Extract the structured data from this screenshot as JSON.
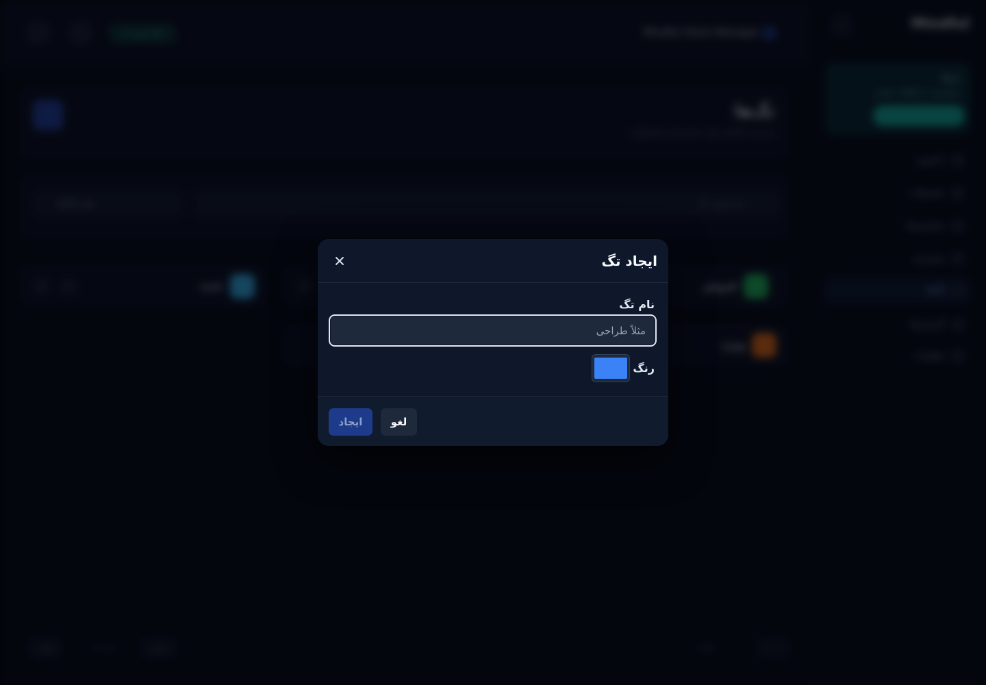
{
  "background": {
    "topbar": {
      "app_title": "Mindful Store Manager",
      "pill_label": "+ تگ جدید"
    },
    "header": {
      "title": "تگ‌ها",
      "subtitle": "مدیریت تگ‌ها برای دسته‌بندی محصولات"
    },
    "filter": {
      "select_label": "همه تگ‌ها",
      "search_placeholder": "جستجوی تگ..."
    },
    "tags": [
      {
        "name": "فروش",
        "color": "#22c55e"
      },
      {
        "name": "جدید",
        "color": "#38bdf8"
      },
      {
        "name": "ویژه",
        "color": "#f97316"
      }
    ],
    "footer": {
      "prev": "قبلی",
      "page_info": "1 از 1",
      "next": "بعدی",
      "summary": "3 تگ"
    },
    "sidebar": {
      "brand": "Mindful",
      "promo": {
        "title": "ارتقا",
        "subtitle": "دسترسی به امکانات بیشتر"
      },
      "items": [
        {
          "label": "داشبورد"
        },
        {
          "label": "محصولات"
        },
        {
          "label": "سفارش‌ها"
        },
        {
          "label": "مشتریان"
        },
        {
          "label": "تگ‌ها"
        },
        {
          "label": "گزارش‌ها"
        },
        {
          "label": "تنظیمات"
        }
      ]
    }
  },
  "modal": {
    "title": "ایجاد تگ",
    "name_label": "نام تگ",
    "name_placeholder": "مثلاً طراحی",
    "name_value": "",
    "color_label": "رنگ",
    "color_value": "#3b82f6",
    "cancel_label": "لغو",
    "create_label": "ایجاد"
  }
}
